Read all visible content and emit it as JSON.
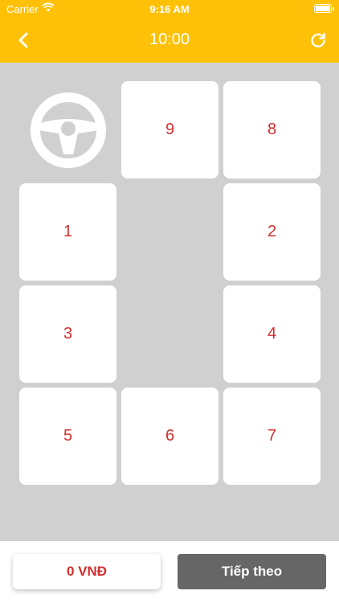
{
  "status_bar": {
    "carrier": "Carrier",
    "time": "9:16 AM"
  },
  "nav": {
    "title": "10:00",
    "back_icon": "chevron-left-icon",
    "refresh_icon": "refresh-icon"
  },
  "seats": [
    {
      "id": "9",
      "label": "9"
    },
    {
      "id": "8",
      "label": "8"
    },
    {
      "id": "1",
      "label": "1"
    },
    {
      "id": "2",
      "label": "2"
    },
    {
      "id": "3",
      "label": "3"
    },
    {
      "id": "4",
      "label": "4"
    },
    {
      "id": "5",
      "label": "5"
    },
    {
      "id": "6",
      "label": "6"
    },
    {
      "id": "7",
      "label": "7"
    }
  ],
  "footer": {
    "total": "0 VNĐ",
    "next_label": "Tiếp theo"
  },
  "colors": {
    "primary": "#FFC107",
    "seat_text": "#d32f2f",
    "button_dark": "#666666",
    "background": "#d0d0d0"
  }
}
